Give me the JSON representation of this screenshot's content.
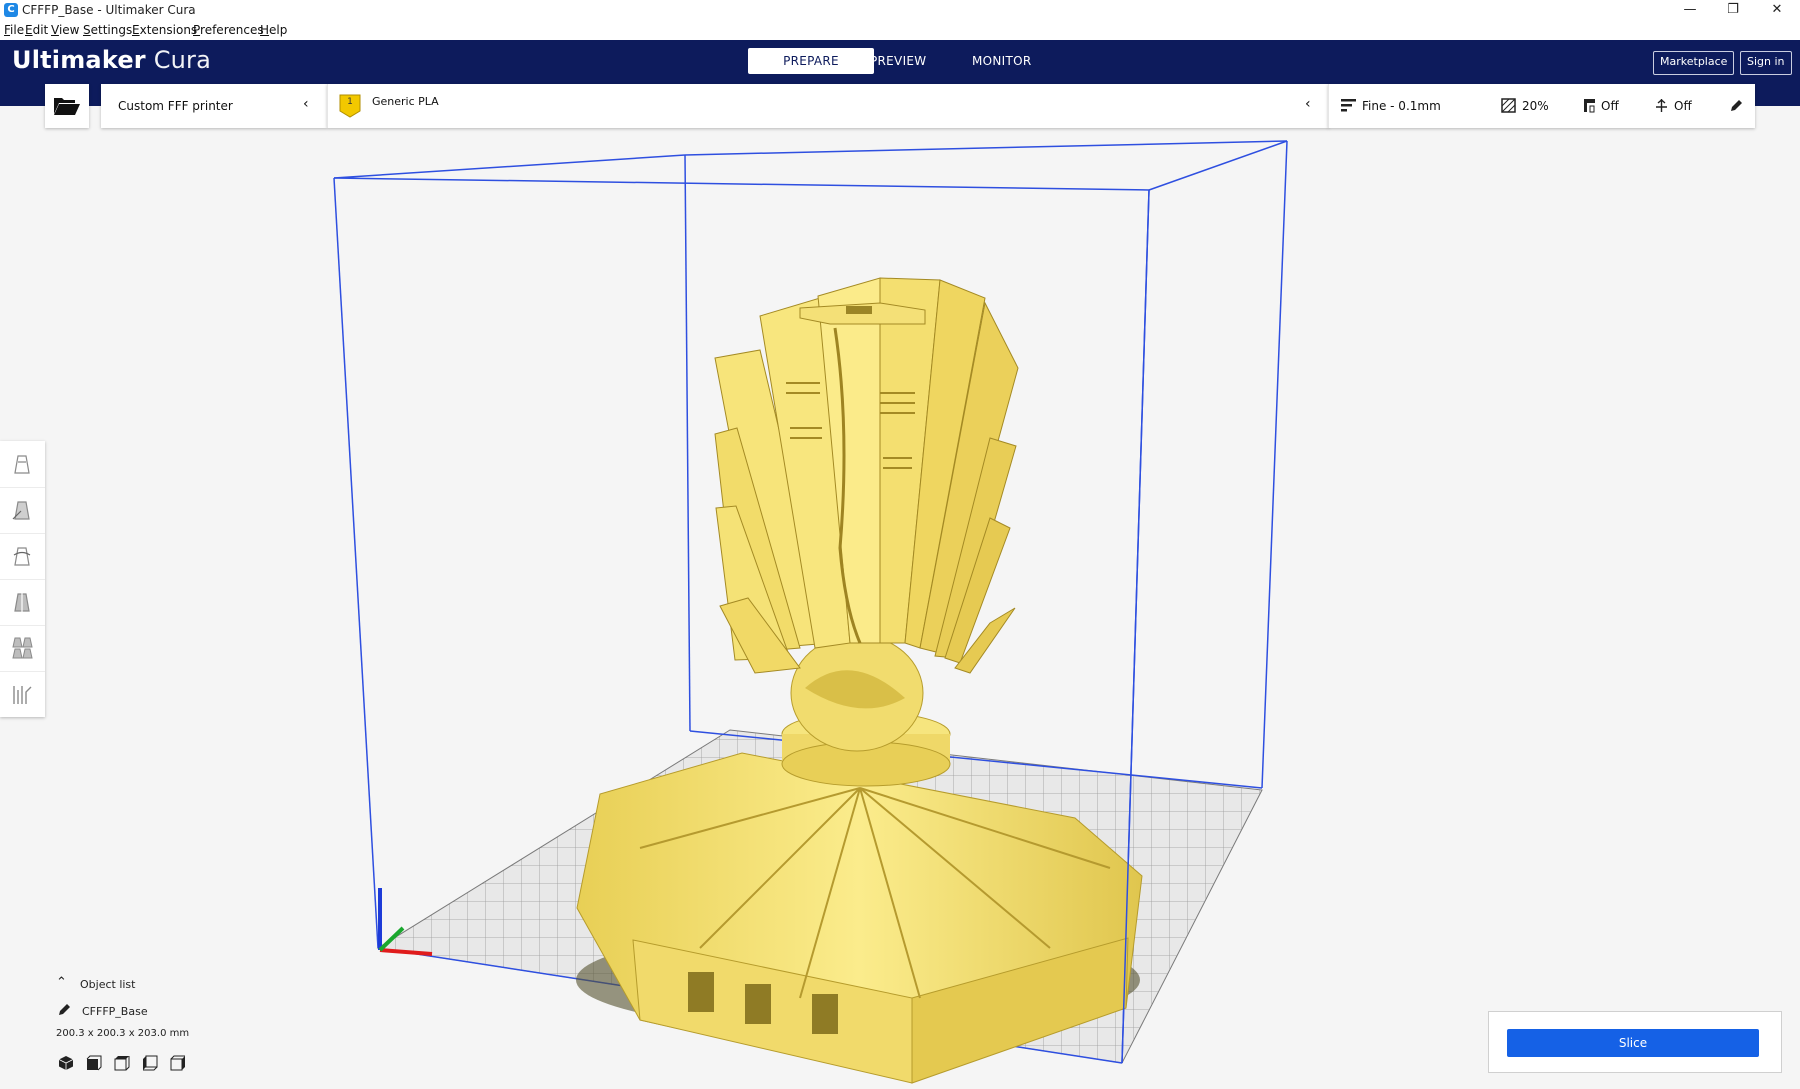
{
  "window": {
    "title": "CFFFP_Base - Ultimaker Cura",
    "app_icon": "C",
    "minimize": "—",
    "maximize": "❐",
    "close": "✕"
  },
  "menu": [
    {
      "accel": "F",
      "rest": "ile"
    },
    {
      "accel": "E",
      "rest": "dit"
    },
    {
      "accel": "V",
      "rest": "iew"
    },
    {
      "accel": "S",
      "rest": "ettings"
    },
    {
      "accel": "E",
      "rest": "xtensions"
    },
    {
      "accel": "P",
      "rest": "references"
    },
    {
      "accel": "H",
      "rest": "elp"
    }
  ],
  "header": {
    "brand_main": "Ultimaker",
    "brand_sub": " Cura",
    "tabs": [
      {
        "label": "PREPARE",
        "active": true
      },
      {
        "label": "PREVIEW",
        "active": false
      },
      {
        "label": "MONITOR",
        "active": false
      }
    ],
    "marketplace": "Marketplace",
    "signin": "Sign in"
  },
  "toolbar": {
    "printer": "Custom FFF printer",
    "extruder_number": "1",
    "material": "Generic PLA",
    "profile": "Fine - 0.1mm",
    "infill": "20%",
    "support": "Off",
    "adhesion": "Off"
  },
  "left_tools": [
    "move-tool-icon",
    "scale-tool-icon",
    "rotate-tool-icon",
    "mirror-tool-icon",
    "per-model-settings-icon",
    "support-blocker-icon"
  ],
  "object_list": {
    "toggle_label": "Object list",
    "object_name": "CFFFP_Base",
    "dimensions": "200.3 x 200.3 x 203.0 mm"
  },
  "slice": {
    "button_label": "Slice"
  },
  "colors": {
    "header_bg": "#0d1b5c",
    "model_yellow": "#f5e37a",
    "slice_blue": "#1561e6",
    "build_volume_outline": "#2e4fe0"
  }
}
